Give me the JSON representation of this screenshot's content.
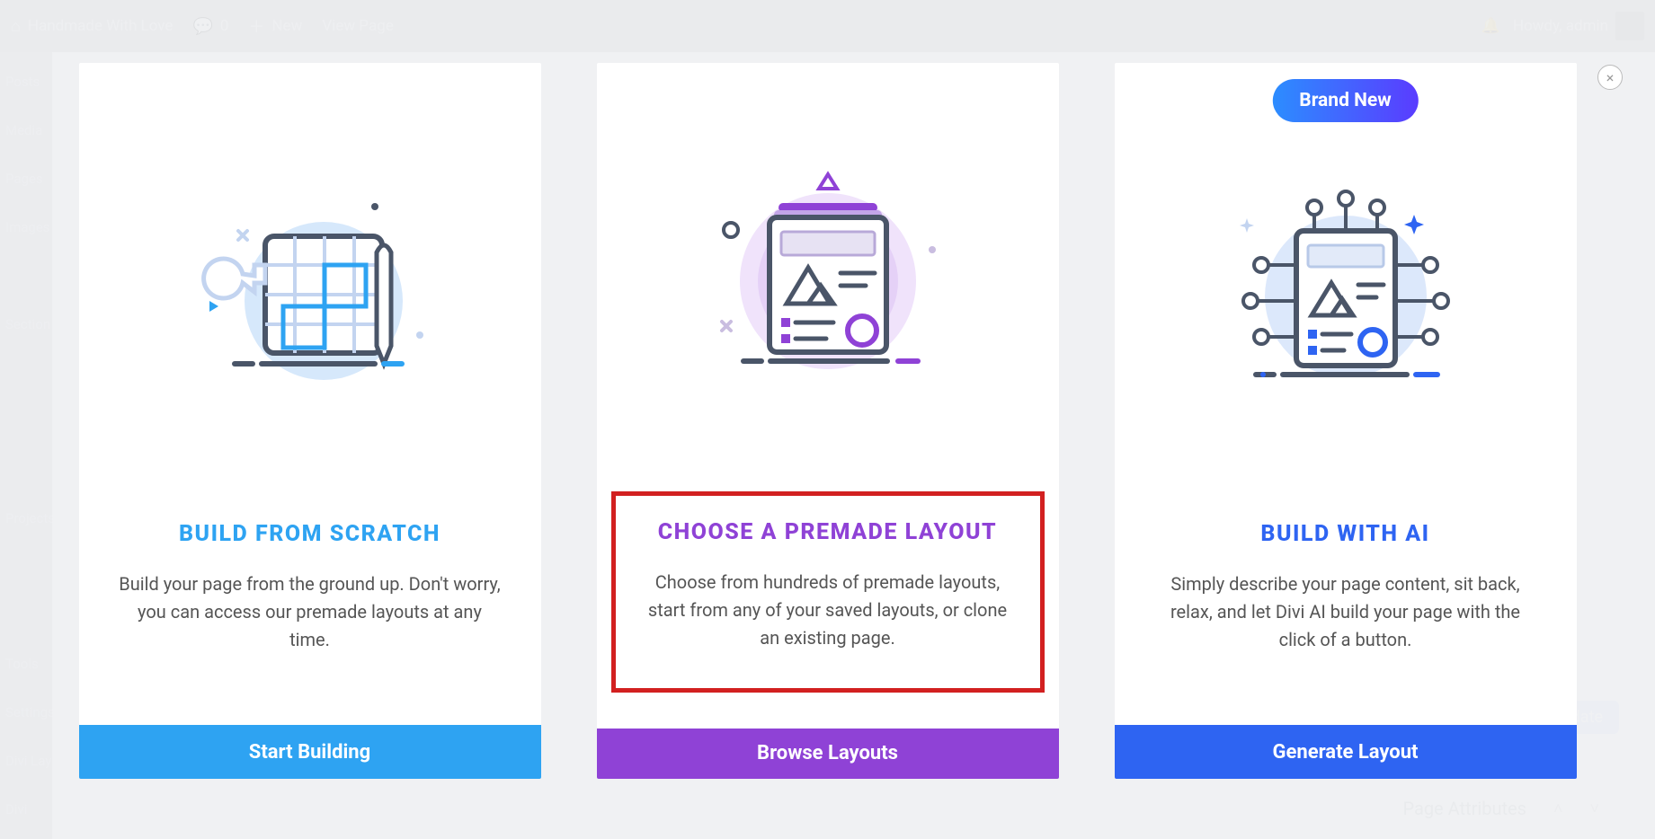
{
  "adminbar": {
    "site_name": "Handmade With Love",
    "comments": "0",
    "new": "New",
    "view_page": "View Page",
    "howdy": "Howdy, admin"
  },
  "sidebar": {
    "items": [
      "Posts",
      "Media",
      "Pages",
      "Images",
      "",
      "Section",
      "",
      "",
      "",
      "Projects",
      "",
      "",
      "Tools",
      "Settings",
      "Divi Layouts",
      "Divi"
    ]
  },
  "close_label": "×",
  "cards": [
    {
      "title": "BUILD FROM SCRATCH",
      "desc": "Build your page from the ground up. Don't worry, you can access our premade layouts at any time.",
      "button": "Start Building"
    },
    {
      "title": "CHOOSE A PREMADE LAYOUT",
      "desc": "Choose from hundreds of premade layouts, start from any of your saved layouts, or clone an existing page.",
      "button": "Browse Layouts"
    },
    {
      "badge": "Brand New",
      "title": "BUILD WITH AI",
      "desc": "Simply describe your page content, sit back, relax, and let Divi AI build your page with the click of a button.",
      "button": "Generate Layout"
    }
  ],
  "page_attributes_label": "Page Attributes",
  "update_label": "Update"
}
